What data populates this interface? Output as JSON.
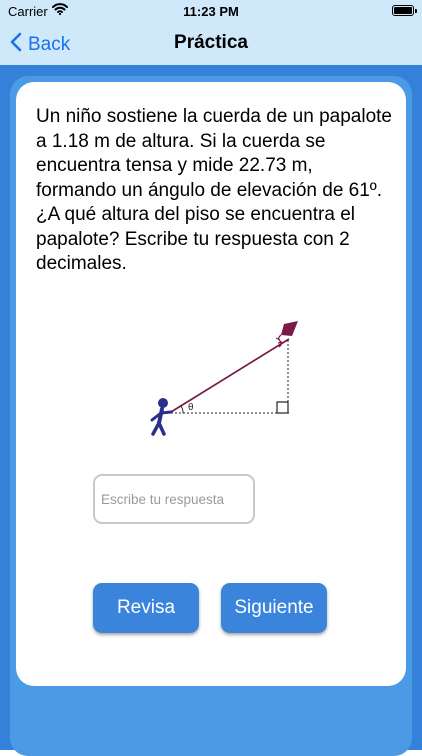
{
  "status_bar": {
    "carrier": "Carrier",
    "time": "11:23 PM"
  },
  "nav": {
    "back_label": "Back",
    "title": "Práctica"
  },
  "question": {
    "text": "Un niño sostiene la cuerda de un papalote a 1.18 m de altura. Si la cuerda se encuentra tensa y mide 22.73 m, formando un ángulo de elevación de 61º. ¿A qué altura del piso se encuentra el papalote? Escribe tu respuesta con 2 decimales."
  },
  "diagram": {
    "angle_label": "θ"
  },
  "answer": {
    "placeholder": "Escribe tu respuesta"
  },
  "buttons": {
    "check_label": "Revisa",
    "next_label": "Siguiente"
  },
  "colors": {
    "nav_background": "#cfe8fa",
    "main_background": "#3381d8",
    "button": "#3a85db",
    "kite": "#7a1a4a",
    "child": "#2b2e8a",
    "back_link": "#1a73e8"
  }
}
